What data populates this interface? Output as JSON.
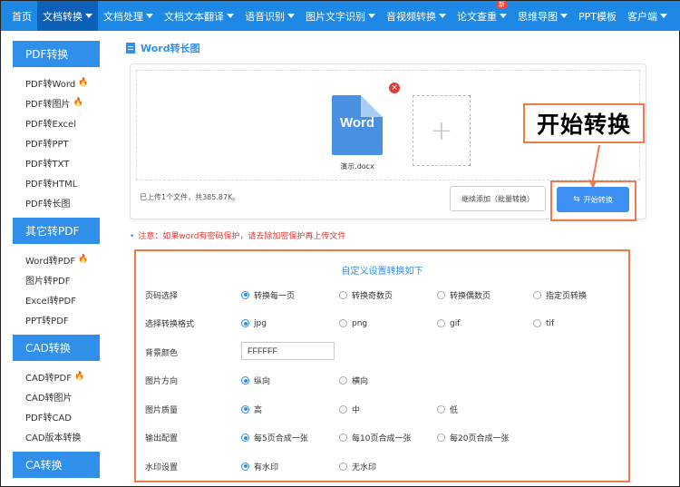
{
  "nav": {
    "items": [
      {
        "label": "首页",
        "caret": false,
        "active": false
      },
      {
        "label": "文档转换",
        "caret": true,
        "active": true
      },
      {
        "label": "文档处理",
        "caret": true,
        "active": false
      },
      {
        "label": "文档文本翻译",
        "caret": true,
        "active": false
      },
      {
        "label": "语音识别",
        "caret": true,
        "active": false
      },
      {
        "label": "图片文字识别",
        "caret": true,
        "active": false
      },
      {
        "label": "音视频转换",
        "caret": true,
        "active": false
      },
      {
        "label": "论文查重",
        "caret": true,
        "active": false,
        "badge": "新"
      },
      {
        "label": "思维导图",
        "caret": true,
        "active": false
      },
      {
        "label": "PPT模板",
        "caret": false,
        "active": false
      },
      {
        "label": "客户端",
        "caret": true,
        "active": false
      }
    ]
  },
  "sidebar": {
    "sections": [
      {
        "title": "PDF转换",
        "links": [
          {
            "label": "PDF转Word",
            "hot": true
          },
          {
            "label": "PDF转图片",
            "hot": true
          },
          {
            "label": "PDF转Excel",
            "hot": false
          },
          {
            "label": "PDF转PPT",
            "hot": false
          },
          {
            "label": "PDF转TXT",
            "hot": false
          },
          {
            "label": "PDF转HTML",
            "hot": false
          },
          {
            "label": "PDF转长图",
            "hot": false
          }
        ]
      },
      {
        "title": "其它转PDF",
        "links": [
          {
            "label": "Word转PDF",
            "hot": true
          },
          {
            "label": "图片转PDF",
            "hot": false
          },
          {
            "label": "Excel转PDF",
            "hot": false
          },
          {
            "label": "PPT转PDF",
            "hot": false
          }
        ]
      },
      {
        "title": "CAD转换",
        "links": [
          {
            "label": "CAD转PDF",
            "hot": true
          },
          {
            "label": "CAD转图片",
            "hot": false
          },
          {
            "label": "PDF转CAD",
            "hot": false
          },
          {
            "label": "CAD版本转换",
            "hot": false
          }
        ]
      },
      {
        "title": "CA转换",
        "links": []
      }
    ]
  },
  "page": {
    "title": "Word转长图"
  },
  "upload": {
    "file_icon_text": "Word",
    "file_name": "演示.docx",
    "close_glyph": "×",
    "add_glyph": "+",
    "status": "已上传1个文件，共385.87K。",
    "continue_label": "继续添加（批量转换）",
    "start_label": "开始转换",
    "callout_label": "开始转换"
  },
  "notice": "注意：如果word有密码保护，请去除加密保护再上传文件",
  "settings": {
    "title": "自定义设置转换如下",
    "rows": [
      {
        "label": "页码选择",
        "options": [
          "转换每一页",
          "转换奇数页",
          "转换偶数页",
          "指定页转换"
        ],
        "selected": 0
      },
      {
        "label": "选择转换格式",
        "options": [
          "jpg",
          "png",
          "gif",
          "tif"
        ],
        "selected": 0
      },
      {
        "label": "背景颜色",
        "input": "FFFFFF"
      },
      {
        "label": "图片方向",
        "options": [
          "纵向",
          "横向"
        ],
        "selected": 0
      },
      {
        "label": "图片质量",
        "options": [
          "高",
          "中",
          "低"
        ],
        "selected": 0
      },
      {
        "label": "输出配置",
        "options": [
          "每5页合成一张",
          "每10页合成一张",
          "每20页合成一张"
        ],
        "selected": 0
      },
      {
        "label": "水印设置",
        "options": [
          "有水印",
          "无水印"
        ],
        "selected": 0
      }
    ]
  },
  "colors": {
    "primary": "#2f8fea",
    "nav": "#1e88e5",
    "highlight": "#f07a4a",
    "warning": "#e53935"
  },
  "icons": {
    "hot": "fire-icon",
    "close": "close-icon",
    "add": "plus-icon",
    "swap": "swap-icon",
    "doc": "document-icon"
  }
}
